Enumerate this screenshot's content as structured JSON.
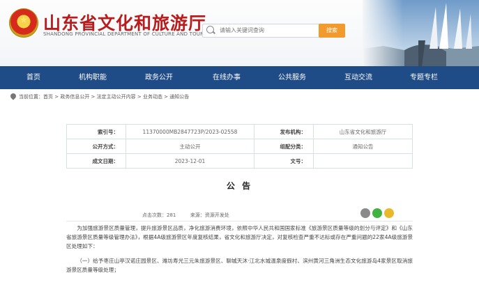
{
  "header": {
    "title": "山东省文化和旅游厅",
    "subtitle": "SHANDONG PROVINCIAL DEPARTMENT OF CULTURE AND TOURISM",
    "search_placeholder": "请输入关键词查询",
    "search_button": "搜索"
  },
  "nav": {
    "items": [
      "首页",
      "机构职能",
      "政务公开",
      "在线办事",
      "公共服务",
      "互动交流",
      "专题专栏"
    ]
  },
  "breadcrumb": {
    "text": "当前位置：首页 > 政务信息公开 > 法定主动公开内容 > 业务动态 > 通知公告"
  },
  "meta": {
    "labels": {
      "index": "索引号：",
      "publisher": "发布机构：",
      "open_method": "公开方式：",
      "category": "组配分类：",
      "date": "成文日期：",
      "doc_no": "文号："
    },
    "values": {
      "index": "11370000MB2847723P/2023-02558",
      "publisher": "山东省文化和旅游厅",
      "open_method": "主动公开",
      "category": "通知公告",
      "date": "2023-12-01",
      "doc_no": ""
    }
  },
  "article": {
    "title": "公 告",
    "views_label": "点击次数：",
    "views": "281",
    "source_label": "来源：",
    "source": "资源开发处",
    "paragraph1": "为加强旅游景区质量管理，提升旅游景区品质，净化旅游消费环境，依照中华人民共和国国家标准《旅游景区质量等级的划分与评定》和《山东省旅游景区质量等级管理办法》，根据4A级旅游景区年度复核结果，省文化和旅游厅决定，对复核检查严重不达标或存在严重问题的22家4A级旅游景区处理如下：",
    "paragraph2": "（一）给予枣庄山亭汉诺庄园景区、潍坊寿光三元朱旅游景区、聊城天沐·江北水城温泉度假村、滨州黄河三角洲生态文化旅游岛4家景区取消旅游景区质量等级处理；"
  },
  "colors": {
    "nav_bg": "#1f4b87",
    "title_red": "#b81c1c",
    "search_orange": "#f39a2c"
  },
  "icons": [
    "emblem-icon",
    "search-icon",
    "location-icon",
    "eye-icon",
    "wechat-icon",
    "qzone-icon"
  ]
}
